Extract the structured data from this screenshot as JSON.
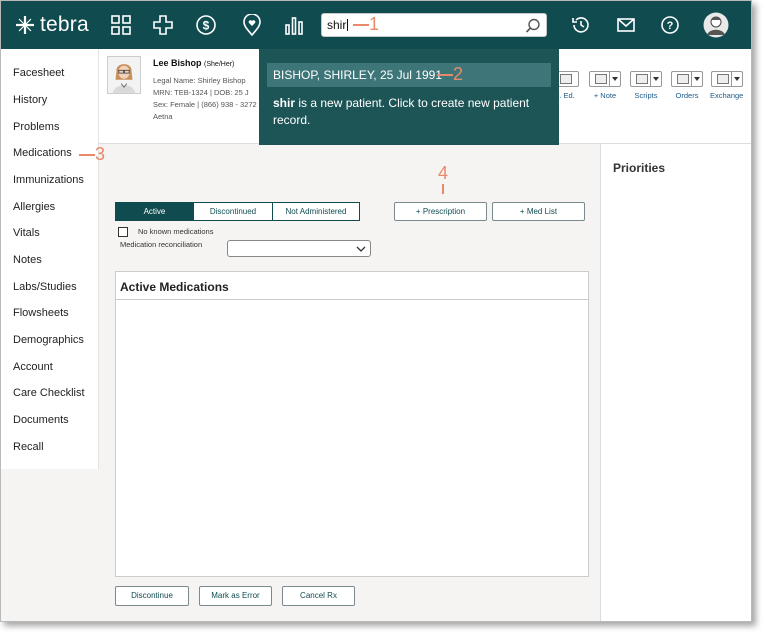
{
  "app": {
    "logo_text": "tebra"
  },
  "nav": {
    "icons": [
      "apps-grid-icon",
      "medical-cross-icon",
      "billing-dollar-icon",
      "location-heart-icon",
      "reports-bar-chart-icon",
      "history-clock-icon",
      "mail-icon",
      "help-icon",
      "user-avatar"
    ]
  },
  "search": {
    "value": "shir"
  },
  "search_dropdown": {
    "result": "BISHOP, SHIRLEY, 25 Jul 1991",
    "new_patient_bold": "shir",
    "new_patient_rest": " is a new patient. Click to create new patient record."
  },
  "callouts": {
    "c1": "1",
    "c2": "2",
    "c3": "3",
    "c4": "4"
  },
  "patient": {
    "name": "Lee Bishop",
    "pronouns": "(She/Her)",
    "legal_name": "Legal Name: Shirley Bishop",
    "mrn_dob": "MRN: TEB-1324 | DOB: 25 J",
    "sex_phone": "Sex: Female | (866) 938 - 3272",
    "insurance": "Aetna"
  },
  "toolbar": [
    {
      "label": "t. Ed.",
      "icon": "book-icon"
    },
    {
      "label": "+ Note",
      "icon": "note-icon"
    },
    {
      "label": "Scripts",
      "icon": "rx-icon"
    },
    {
      "label": "Orders",
      "icon": "clipboard-icon"
    },
    {
      "label": "Exchange",
      "icon": "exchange-icon"
    }
  ],
  "sidebar": {
    "items": [
      {
        "label": "Facesheet"
      },
      {
        "label": "History"
      },
      {
        "label": "Problems"
      },
      {
        "label": "Medications"
      },
      {
        "label": "Immunizations"
      },
      {
        "label": "Allergies"
      },
      {
        "label": "Vitals"
      },
      {
        "label": "Notes"
      },
      {
        "label": "Labs/Studies"
      },
      {
        "label": "Flowsheets"
      },
      {
        "label": "Demographics"
      },
      {
        "label": "Account"
      },
      {
        "label": "Care Checklist"
      },
      {
        "label": "Documents"
      },
      {
        "label": "Recall"
      }
    ]
  },
  "medications": {
    "tabs": [
      "Active",
      "Discontinued",
      "Not Administered"
    ],
    "prescription_button": "+ Prescription",
    "med_list_button": "+ Med List",
    "no_known_label": "No known medications",
    "reconciliation_label": "Medication reconciliation",
    "reconciliation_value": "",
    "section_title": "Active Medications",
    "bottom_buttons": [
      "Discontinue",
      "Mark as Error",
      "Cancel Rx"
    ]
  },
  "right_panel": {
    "title": "Priorities"
  },
  "colors": {
    "nav_bg": "#0f4b4f",
    "dropdown_bg": "#1d5557",
    "callout": "#e8896a"
  }
}
